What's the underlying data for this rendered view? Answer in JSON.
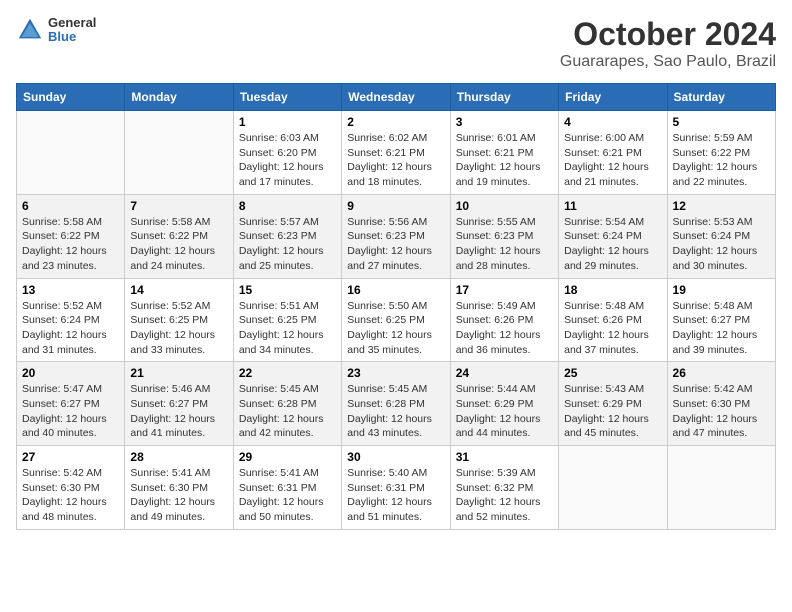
{
  "logo": {
    "general": "General",
    "blue": "Blue"
  },
  "title": "October 2024",
  "subtitle": "Guararapes, Sao Paulo, Brazil",
  "headers": [
    "Sunday",
    "Monday",
    "Tuesday",
    "Wednesday",
    "Thursday",
    "Friday",
    "Saturday"
  ],
  "weeks": [
    [
      {
        "day": "",
        "info": ""
      },
      {
        "day": "",
        "info": ""
      },
      {
        "day": "1",
        "info": "Sunrise: 6:03 AM\nSunset: 6:20 PM\nDaylight: 12 hours and 17 minutes."
      },
      {
        "day": "2",
        "info": "Sunrise: 6:02 AM\nSunset: 6:21 PM\nDaylight: 12 hours and 18 minutes."
      },
      {
        "day": "3",
        "info": "Sunrise: 6:01 AM\nSunset: 6:21 PM\nDaylight: 12 hours and 19 minutes."
      },
      {
        "day": "4",
        "info": "Sunrise: 6:00 AM\nSunset: 6:21 PM\nDaylight: 12 hours and 21 minutes."
      },
      {
        "day": "5",
        "info": "Sunrise: 5:59 AM\nSunset: 6:22 PM\nDaylight: 12 hours and 22 minutes."
      }
    ],
    [
      {
        "day": "6",
        "info": "Sunrise: 5:58 AM\nSunset: 6:22 PM\nDaylight: 12 hours and 23 minutes."
      },
      {
        "day": "7",
        "info": "Sunrise: 5:58 AM\nSunset: 6:22 PM\nDaylight: 12 hours and 24 minutes."
      },
      {
        "day": "8",
        "info": "Sunrise: 5:57 AM\nSunset: 6:23 PM\nDaylight: 12 hours and 25 minutes."
      },
      {
        "day": "9",
        "info": "Sunrise: 5:56 AM\nSunset: 6:23 PM\nDaylight: 12 hours and 27 minutes."
      },
      {
        "day": "10",
        "info": "Sunrise: 5:55 AM\nSunset: 6:23 PM\nDaylight: 12 hours and 28 minutes."
      },
      {
        "day": "11",
        "info": "Sunrise: 5:54 AM\nSunset: 6:24 PM\nDaylight: 12 hours and 29 minutes."
      },
      {
        "day": "12",
        "info": "Sunrise: 5:53 AM\nSunset: 6:24 PM\nDaylight: 12 hours and 30 minutes."
      }
    ],
    [
      {
        "day": "13",
        "info": "Sunrise: 5:52 AM\nSunset: 6:24 PM\nDaylight: 12 hours and 31 minutes."
      },
      {
        "day": "14",
        "info": "Sunrise: 5:52 AM\nSunset: 6:25 PM\nDaylight: 12 hours and 33 minutes."
      },
      {
        "day": "15",
        "info": "Sunrise: 5:51 AM\nSunset: 6:25 PM\nDaylight: 12 hours and 34 minutes."
      },
      {
        "day": "16",
        "info": "Sunrise: 5:50 AM\nSunset: 6:25 PM\nDaylight: 12 hours and 35 minutes."
      },
      {
        "day": "17",
        "info": "Sunrise: 5:49 AM\nSunset: 6:26 PM\nDaylight: 12 hours and 36 minutes."
      },
      {
        "day": "18",
        "info": "Sunrise: 5:48 AM\nSunset: 6:26 PM\nDaylight: 12 hours and 37 minutes."
      },
      {
        "day": "19",
        "info": "Sunrise: 5:48 AM\nSunset: 6:27 PM\nDaylight: 12 hours and 39 minutes."
      }
    ],
    [
      {
        "day": "20",
        "info": "Sunrise: 5:47 AM\nSunset: 6:27 PM\nDaylight: 12 hours and 40 minutes."
      },
      {
        "day": "21",
        "info": "Sunrise: 5:46 AM\nSunset: 6:27 PM\nDaylight: 12 hours and 41 minutes."
      },
      {
        "day": "22",
        "info": "Sunrise: 5:45 AM\nSunset: 6:28 PM\nDaylight: 12 hours and 42 minutes."
      },
      {
        "day": "23",
        "info": "Sunrise: 5:45 AM\nSunset: 6:28 PM\nDaylight: 12 hours and 43 minutes."
      },
      {
        "day": "24",
        "info": "Sunrise: 5:44 AM\nSunset: 6:29 PM\nDaylight: 12 hours and 44 minutes."
      },
      {
        "day": "25",
        "info": "Sunrise: 5:43 AM\nSunset: 6:29 PM\nDaylight: 12 hours and 45 minutes."
      },
      {
        "day": "26",
        "info": "Sunrise: 5:42 AM\nSunset: 6:30 PM\nDaylight: 12 hours and 47 minutes."
      }
    ],
    [
      {
        "day": "27",
        "info": "Sunrise: 5:42 AM\nSunset: 6:30 PM\nDaylight: 12 hours and 48 minutes."
      },
      {
        "day": "28",
        "info": "Sunrise: 5:41 AM\nSunset: 6:30 PM\nDaylight: 12 hours and 49 minutes."
      },
      {
        "day": "29",
        "info": "Sunrise: 5:41 AM\nSunset: 6:31 PM\nDaylight: 12 hours and 50 minutes."
      },
      {
        "day": "30",
        "info": "Sunrise: 5:40 AM\nSunset: 6:31 PM\nDaylight: 12 hours and 51 minutes."
      },
      {
        "day": "31",
        "info": "Sunrise: 5:39 AM\nSunset: 6:32 PM\nDaylight: 12 hours and 52 minutes."
      },
      {
        "day": "",
        "info": ""
      },
      {
        "day": "",
        "info": ""
      }
    ]
  ]
}
